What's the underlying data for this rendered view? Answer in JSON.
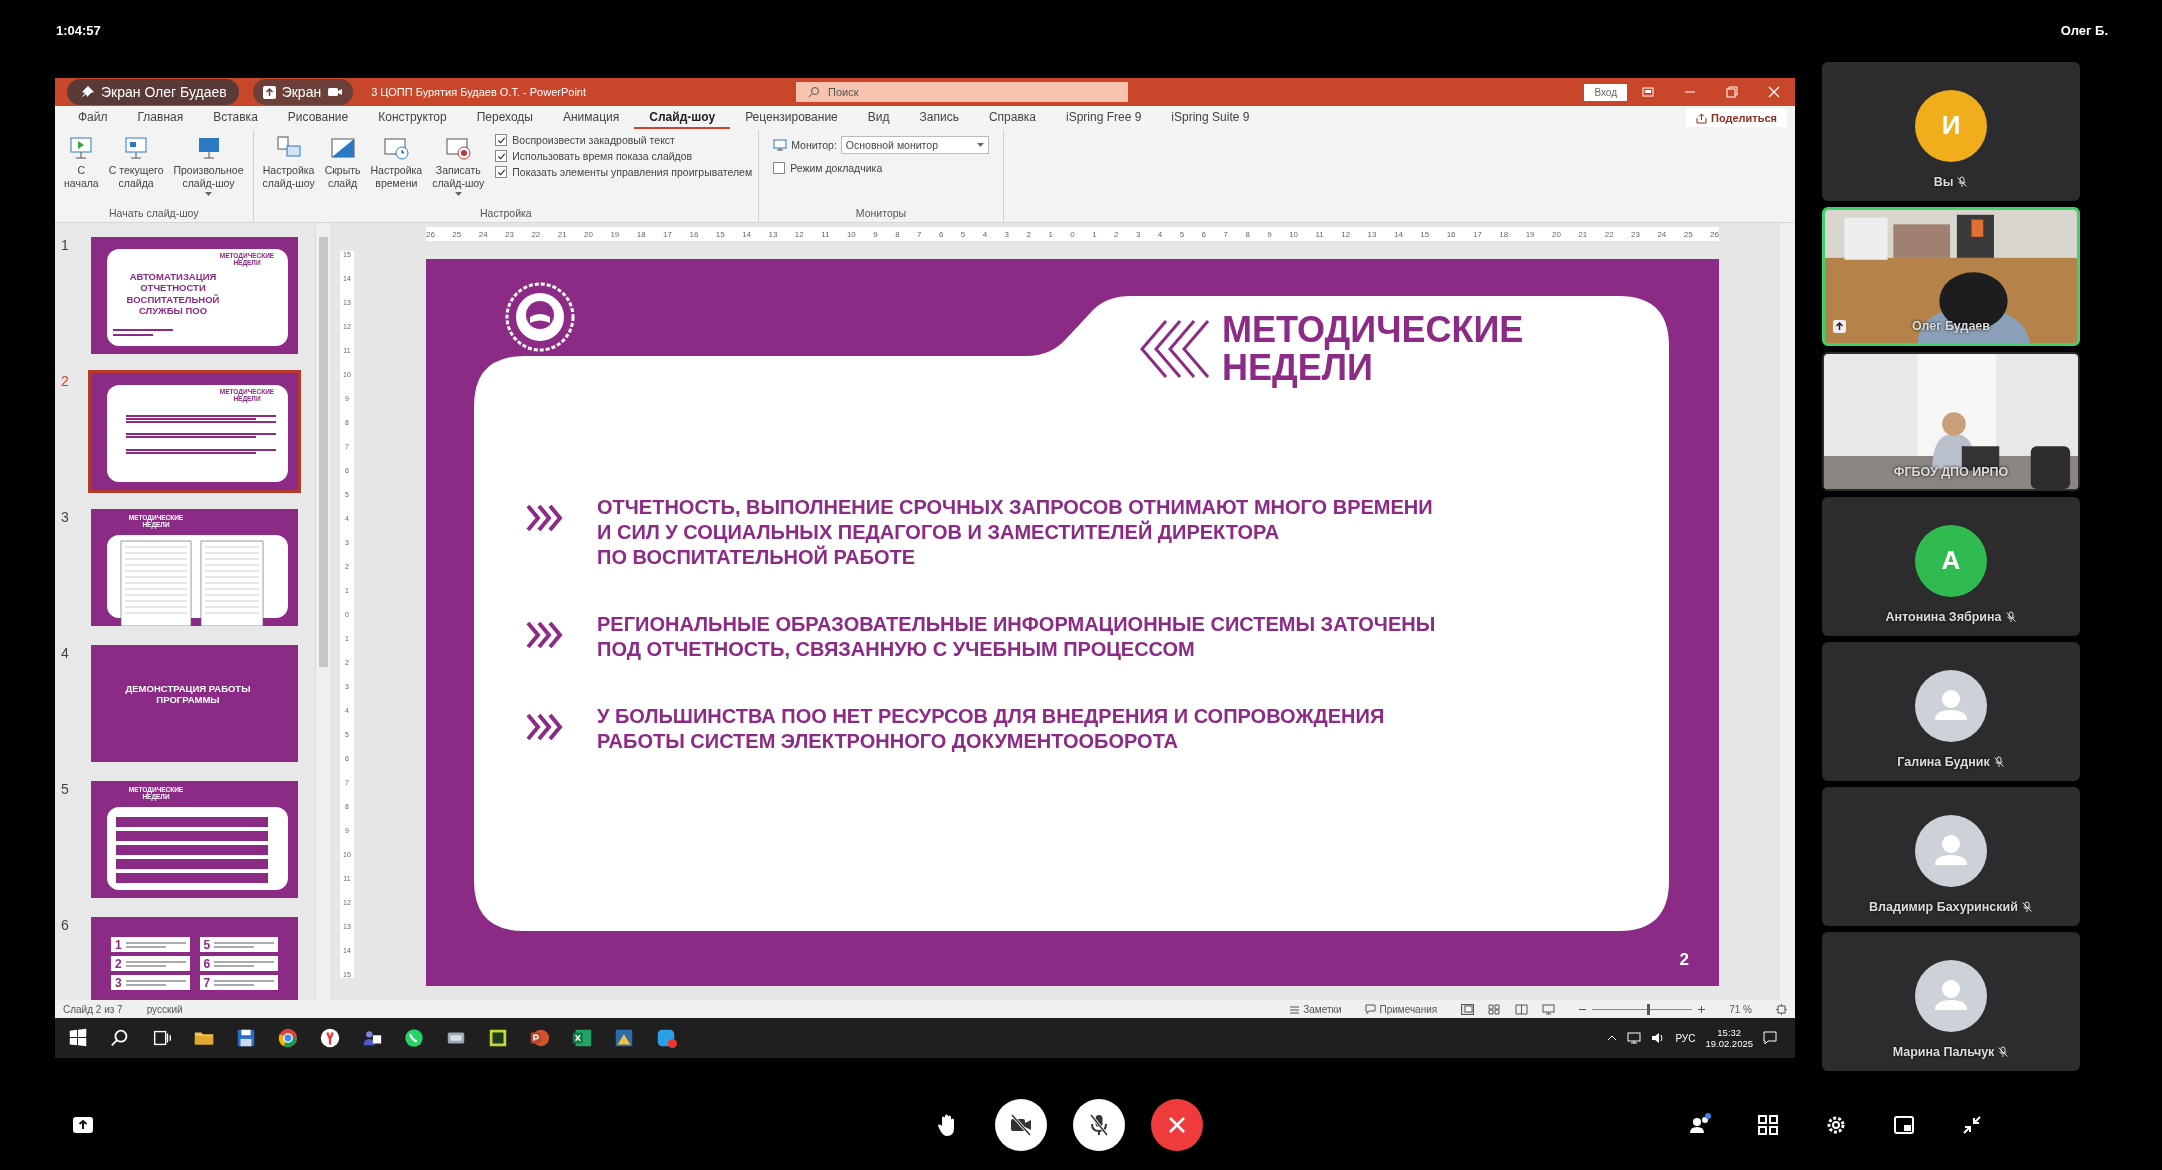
{
  "call_header": {
    "elapsed": "1:04:57",
    "user": "Олег Б."
  },
  "share_overlay": {
    "presenter": "Экран Олег Будаев",
    "screen_button": "Экран"
  },
  "powerpoint": {
    "title": "3 ЦОПП Бурятия Будаев О.Т.  -  PowerPoint",
    "search": {
      "placeholder": "Поиск"
    },
    "sign_in": "Вход",
    "share": "Поделиться",
    "tabs": [
      {
        "label": "Файл",
        "selected": false
      },
      {
        "label": "Главная",
        "selected": false
      },
      {
        "label": "Вставка",
        "selected": false
      },
      {
        "label": "Рисование",
        "selected": false
      },
      {
        "label": "Конструктор",
        "selected": false
      },
      {
        "label": "Переходы",
        "selected": false
      },
      {
        "label": "Анимация",
        "selected": false
      },
      {
        "label": "Слайд-шоу",
        "selected": true
      },
      {
        "label": "Рецензирование",
        "selected": false
      },
      {
        "label": "Вид",
        "selected": false
      },
      {
        "label": "Запись",
        "selected": false
      },
      {
        "label": "Справка",
        "selected": false
      },
      {
        "label": "iSpring Free 9",
        "selected": false
      },
      {
        "label": "iSpring Suite 9",
        "selected": false
      }
    ],
    "ribbon": {
      "start_group": {
        "label": "Начать слайд-шоу",
        "buttons": [
          {
            "label": "С\nначала",
            "has_menu": false
          },
          {
            "label": "С текущего\nслайда",
            "has_menu": false
          },
          {
            "label": "Произвольное\nслайд-шоу",
            "has_menu": true
          }
        ]
      },
      "setup_group": {
        "label": "Настройка",
        "buttons": [
          {
            "label": "Настройка\nслайд-шоу",
            "has_menu": false
          },
          {
            "label": "Скрыть\nслайд",
            "has_menu": false
          },
          {
            "label": "Настройка\nвремени",
            "has_menu": false
          },
          {
            "label": "Записать\nслайд-шоу",
            "has_menu": true
          }
        ],
        "checkboxes": [
          {
            "label": "Воспроизвести закадровый текст",
            "checked": true
          },
          {
            "label": "Использовать время показа слайдов",
            "checked": true
          },
          {
            "label": "Показать элементы управления проигрывателем",
            "checked": true
          }
        ]
      },
      "monitors_group": {
        "label": "Мониторы",
        "monitor_label": "Монитор:",
        "monitor_value": "Основной монитор",
        "presenter_view": {
          "label": "Режим докладчика",
          "checked": false
        }
      }
    },
    "ruler_horizontal": [
      "26",
      "25",
      "24",
      "23",
      "22",
      "21",
      "20",
      "19",
      "18",
      "17",
      "16",
      "15",
      "14",
      "13",
      "12",
      "11",
      "10",
      "9",
      "8",
      "7",
      "6",
      "5",
      "4",
      "3",
      "2",
      "1",
      "0",
      "1",
      "2",
      "3",
      "4",
      "5",
      "6",
      "7",
      "8",
      "9",
      "10",
      "11",
      "12",
      "13",
      "14",
      "15",
      "16",
      "17",
      "18",
      "19",
      "20",
      "21",
      "22",
      "23",
      "24",
      "25",
      "26"
    ],
    "ruler_vertical": [
      "15",
      "14",
      "13",
      "12",
      "11",
      "10",
      "9",
      "8",
      "7",
      "6",
      "5",
      "4",
      "3",
      "2",
      "1",
      "0",
      "1",
      "2",
      "3",
      "4",
      "5",
      "6",
      "7",
      "8",
      "9",
      "10",
      "11",
      "12",
      "13",
      "14",
      "15"
    ],
    "slides": [
      {
        "number": "1",
        "selected": false,
        "kind": "title",
        "header": "МЕТОДИЧЕСКИЕ НЕДЕЛИ",
        "title": "АВТОМАТИЗАЦИЯ ОТЧЕТНОСТИ ВОСПИТАТЕЛЬНОЙ СЛУЖБЫ ПОО"
      },
      {
        "number": "2",
        "selected": true,
        "kind": "bullets",
        "header": "МЕТОДИЧЕСКИЕ НЕДЕЛИ"
      },
      {
        "number": "3",
        "selected": false,
        "kind": "forms",
        "header": "МЕТОДИЧЕСКИЕ НЕДЕЛИ"
      },
      {
        "number": "4",
        "selected": false,
        "kind": "section",
        "title": "ДЕМОНСТРАЦИЯ РАБОТЫ ПРОГРАММЫ"
      },
      {
        "number": "5",
        "selected": false,
        "kind": "list",
        "header": "МЕТОДИЧЕСКИЕ НЕДЕЛИ"
      },
      {
        "number": "6",
        "selected": false,
        "kind": "numbered",
        "numbers": [
          "1",
          "5",
          "2",
          "6",
          "3",
          "7"
        ]
      }
    ],
    "current_slide": {
      "header": "МЕТОДИЧЕСКИЕ\nНЕДЕЛИ",
      "bullets": [
        "ОТЧЕТНОСТЬ, ВЫПОЛНЕНИЕ СРОЧНЫХ ЗАПРОСОВ ОТНИМАЮТ МНОГО ВРЕМЕНИ\nИ СИЛ У СОЦИАЛЬНЫХ ПЕДАГОГОВ И ЗАМЕСТИТЕЛЕЙ ДИРЕКТОРА\nПО ВОСПИТАТЕЛЬНОЙ РАБОТЕ",
        "РЕГИОНАЛЬНЫЕ ОБРАЗОВАТЕЛЬНЫЕ ИНФОРМАЦИОННЫЕ СИСТЕМЫ ЗАТОЧЕНЫ\nПОД ОТЧЕТНОСТЬ, СВЯЗАННУЮ С УЧЕБНЫМ ПРОЦЕССОМ",
        "У БОЛЬШИНСТВА ПОО НЕТ РЕСУРСОВ ДЛЯ ВНЕДРЕНИЯ И СОПРОВОЖДЕНИЯ\nРАБОТЫ СИСТЕМ ЭЛЕКТРОННОГО ДОКУМЕНТООБОРОТА"
      ],
      "page_number": "2"
    },
    "status_bar": {
      "slide_position": "Слайд 2 из 7",
      "language": "русский",
      "notes": "Заметки",
      "comments": "Примечания",
      "zoom_slider": {
        "level": 0.55
      },
      "zoom": "71 %"
    }
  },
  "taskbar": {
    "language": "РУС",
    "time": "15:32",
    "date": "19.02.2025"
  },
  "participants": [
    {
      "kind": "avatar",
      "name": "Вы",
      "initial": "И",
      "color": "#f0ae1c",
      "muted": true,
      "speaking": false
    },
    {
      "kind": "video",
      "name": "Олег Будаев",
      "muted": false,
      "speaking": true
    },
    {
      "kind": "video",
      "name": "ФГБОУ ДПО ИРПО",
      "muted": false,
      "speaking": false
    },
    {
      "kind": "avatar",
      "name": "Антонина Зябрина",
      "initial": "А",
      "color": "#2fbb4f",
      "muted": true,
      "speaking": false
    },
    {
      "kind": "silhouette",
      "name": "Галина Будник",
      "muted": true,
      "speaking": false
    },
    {
      "kind": "silhouette",
      "name": "Владимир Бахуринский",
      "muted": true,
      "speaking": false
    },
    {
      "kind": "silhouette",
      "name": "Марина Пальчук",
      "muted": true,
      "speaking": false
    }
  ],
  "call_controls": {
    "camera_on": false,
    "mic_on": false
  }
}
